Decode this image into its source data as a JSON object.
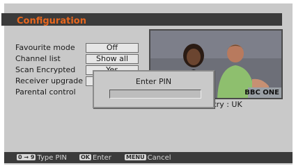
{
  "header": {
    "title": "Configuration"
  },
  "menu": {
    "items": [
      {
        "label": "Favourite mode",
        "value": "Off"
      },
      {
        "label": "Channel list",
        "value": "Show all"
      },
      {
        "label": "Scan Encrypted",
        "value": "Yes"
      },
      {
        "label": "Receiver upgrade",
        "value": ""
      },
      {
        "label": "Parental control",
        "value": ""
      }
    ]
  },
  "preview": {
    "channel": "BBC ONE"
  },
  "info": {
    "country": "Country : UK"
  },
  "pin_dialog": {
    "title": "Enter PIN",
    "value": ""
  },
  "footer": {
    "hints": [
      {
        "key": "0 → 9",
        "label": "Type PIN"
      },
      {
        "key": "OK",
        "label": "Enter"
      },
      {
        "key": "MENU",
        "label": "Cancel"
      }
    ]
  },
  "colors": {
    "accent": "#e8671e",
    "bar": "#3b3b3b",
    "panel": "#c9c9c9"
  }
}
